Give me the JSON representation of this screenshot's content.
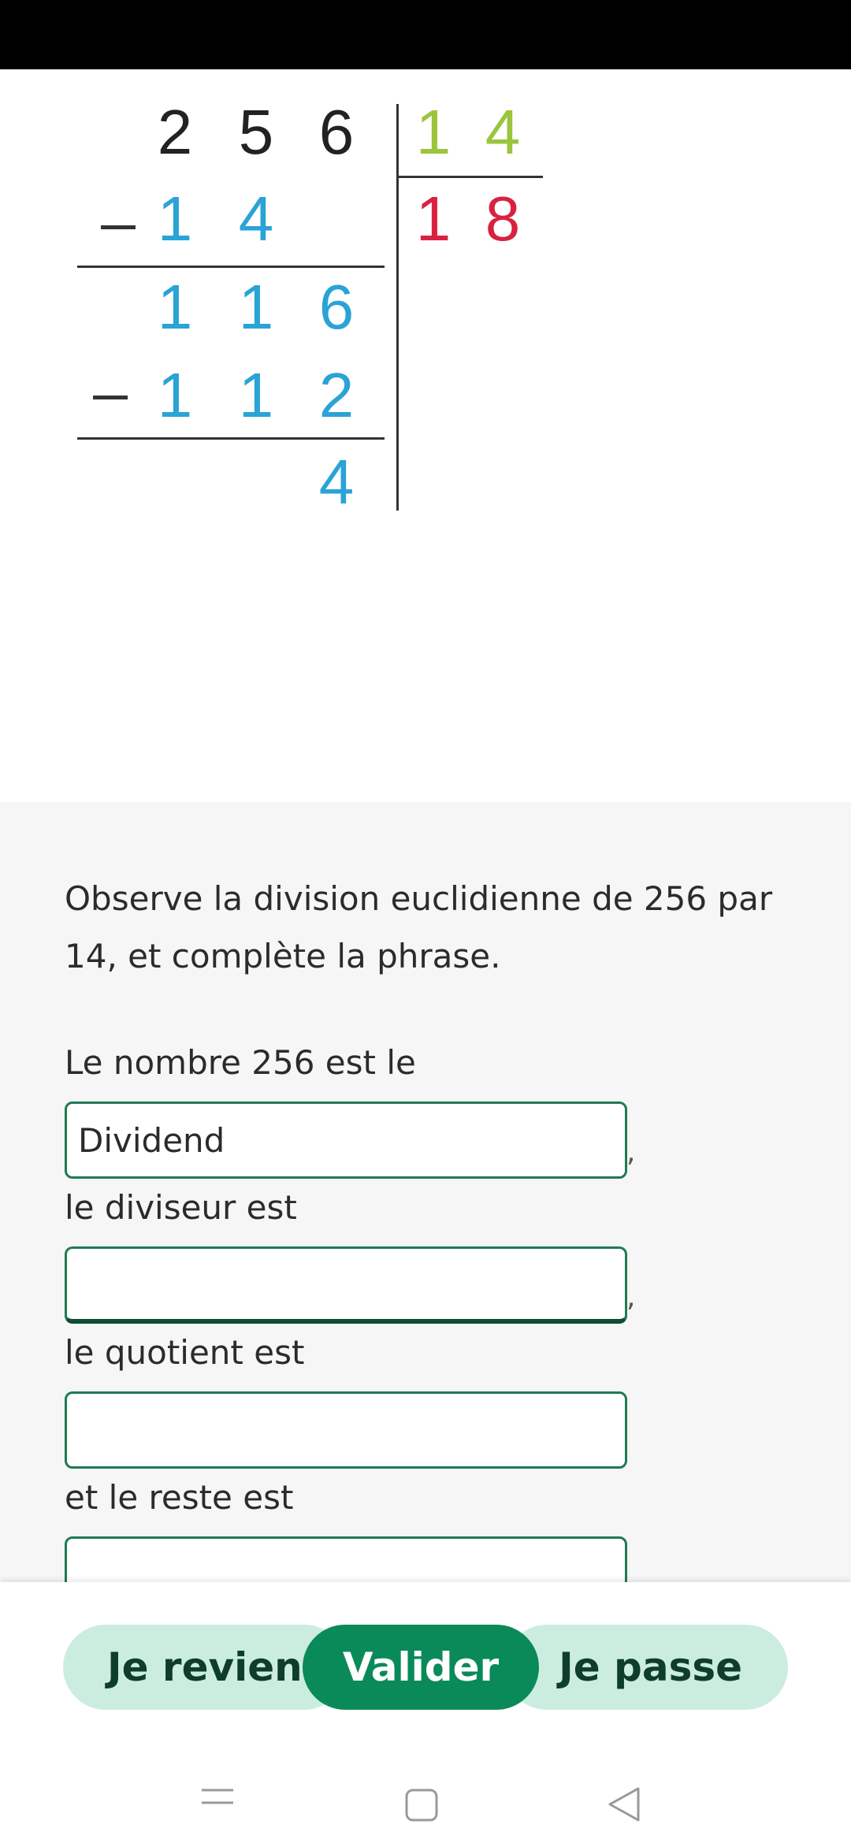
{
  "division": {
    "dividend_digits": [
      "2",
      "5",
      "6"
    ],
    "divisor_digits": [
      "1",
      "4"
    ],
    "quotient_digits": [
      "1",
      "8"
    ],
    "first_product_digits": [
      "1",
      "4"
    ],
    "partial_dividend_digits": [
      "1",
      "1",
      "6"
    ],
    "second_product_digits": [
      "1",
      "1",
      "2"
    ],
    "remainder_digits": [
      "4"
    ],
    "colors": {
      "black": "#222222",
      "blue": "#2aa3d6",
      "green": "#9bc53d",
      "red": "#d8223f"
    }
  },
  "question": {
    "prompt": "Observe la division euclidienne de 256 par 14, et complète la phrase.",
    "fields": [
      {
        "label": "Le nombre 256 est le",
        "value": "Dividend",
        "suffix": ","
      },
      {
        "label": "le diviseur est",
        "value": "",
        "suffix": ","
      },
      {
        "label": "le quotient est",
        "value": "",
        "suffix": ""
      },
      {
        "label": "et le reste est",
        "value": "",
        "suffix": ""
      }
    ]
  },
  "actions": {
    "back_label": "Je reviens",
    "validate_label": "Valider",
    "skip_label": "Je passe"
  },
  "nav": {
    "icons": [
      "menu-icon",
      "home-icon",
      "back-icon"
    ]
  }
}
